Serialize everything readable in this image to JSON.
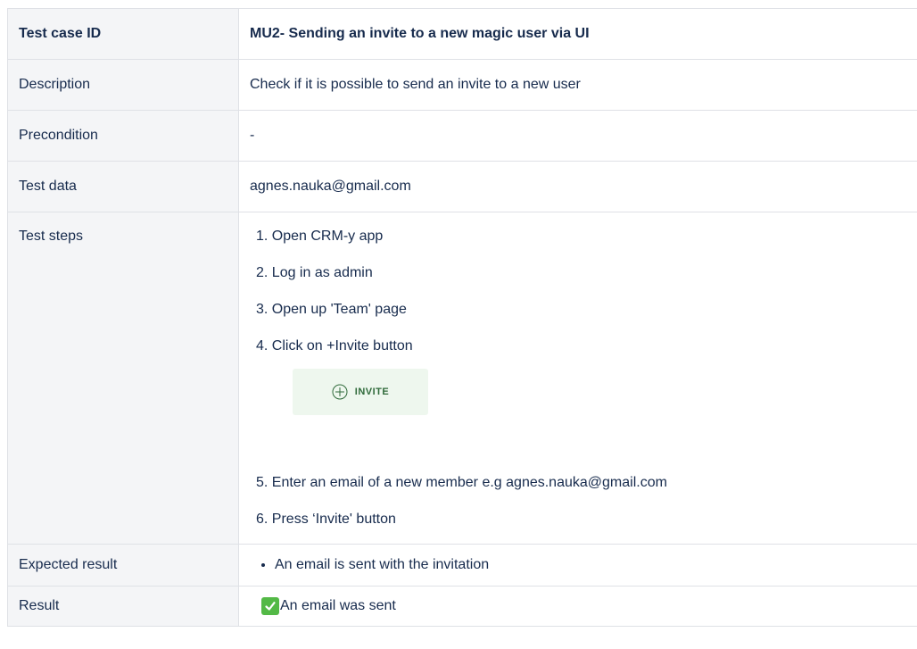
{
  "rows": {
    "header": {
      "key": "Test case ID",
      "value": "MU2- Sending an invite to a new magic user via UI"
    },
    "description": {
      "key": "Description",
      "value": "Check if it is possible to send an invite to a new user"
    },
    "precondition": {
      "key": "Precondition",
      "value": "-"
    },
    "test_data": {
      "key": "Test data",
      "value": "agnes.nauka@gmail.com"
    },
    "test_steps": {
      "key": "Test steps",
      "steps": [
        "1. Open CRM-y app",
        "2. Log in as admin",
        "3. Open up 'Team' page",
        "4. Click on +Invite button",
        "5. Enter an email of a new member e.g agnes.nauka@gmail.com",
        "6. Press ‘Invite' button"
      ],
      "invite_button_label": "INVITE"
    },
    "expected_result": {
      "key": "Expected result",
      "bullets": [
        "An email is sent with the invitation"
      ]
    },
    "result": {
      "key": "Result",
      "value": "An email was sent"
    }
  },
  "colors": {
    "text": "#172b4d",
    "key_cell_bg": "#f4f5f7",
    "border": "#dfe1e6",
    "invite_bg": "#eef7ee",
    "invite_fg": "#2f6a3a",
    "check_green": "#53b946"
  },
  "icons": {
    "invite": "plus-circle-icon",
    "result": "check-mark-icon"
  }
}
